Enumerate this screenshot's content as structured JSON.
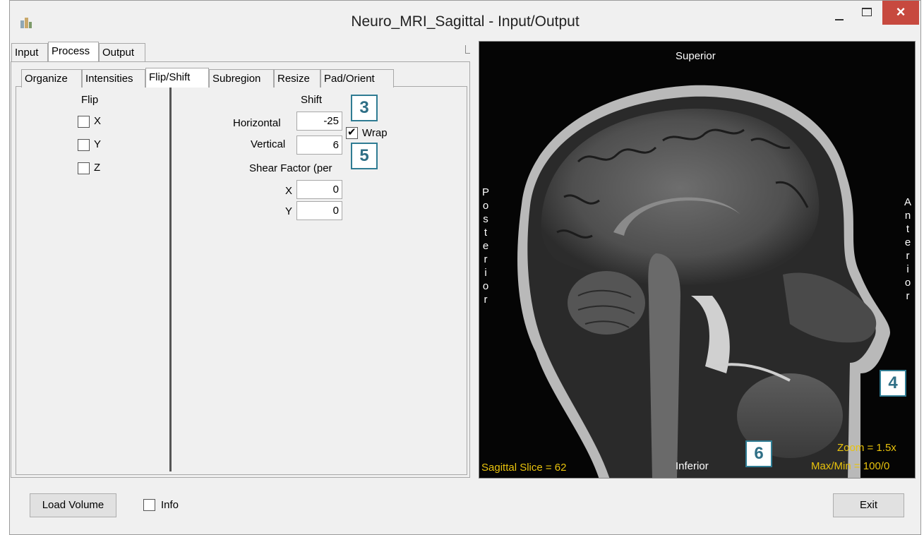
{
  "window": {
    "title": "Neuro_MRI_Sagittal - Input/Output",
    "close_glyph": "×"
  },
  "main_tabs": [
    {
      "label": "Input"
    },
    {
      "label": "Process"
    },
    {
      "label": "Output"
    }
  ],
  "sub_tabs": [
    {
      "label": "Organize"
    },
    {
      "label": "Intensities"
    },
    {
      "label": "Flip/Shift"
    },
    {
      "label": "Subregion"
    },
    {
      "label": "Resize"
    },
    {
      "label": "Pad/Orient"
    }
  ],
  "flip": {
    "heading": "Flip",
    "options": [
      {
        "label": "X",
        "checked": false
      },
      {
        "label": "Y",
        "checked": false
      },
      {
        "label": "Z",
        "checked": false
      }
    ]
  },
  "shift": {
    "heading": "Shift",
    "horizontal_label": "Horizontal",
    "horizontal_value": "-25",
    "vertical_label": "Vertical",
    "vertical_value": "6",
    "wrap_label": "Wrap",
    "wrap_checked": true,
    "shear_heading": "Shear Factor (per",
    "shear_x_label": "X",
    "shear_x_value": "0",
    "shear_y_label": "Y",
    "shear_y_value": "0"
  },
  "viewer": {
    "top_label": "Superior",
    "bottom_label": "Inferior",
    "left_label": "Posterior",
    "right_label": "Anterior",
    "slice_text": "Sagittal Slice = 62",
    "zoom_text": "Zoom = 1.5x",
    "maxmin_text": "Max/Min = 100/0"
  },
  "callouts": [
    "3",
    "4",
    "5",
    "6"
  ],
  "bottom": {
    "load_label": "Load Volume",
    "info_label": "Info",
    "info_checked": false,
    "exit_label": "Exit"
  },
  "colors": {
    "callout_border": "#2f7c93",
    "overlay_text": "#e8c20c",
    "close_button": "#c7493f"
  },
  "icons": [
    "app-icon",
    "minimize-icon",
    "maximize-icon",
    "close-icon",
    "checkmark-icon"
  ]
}
